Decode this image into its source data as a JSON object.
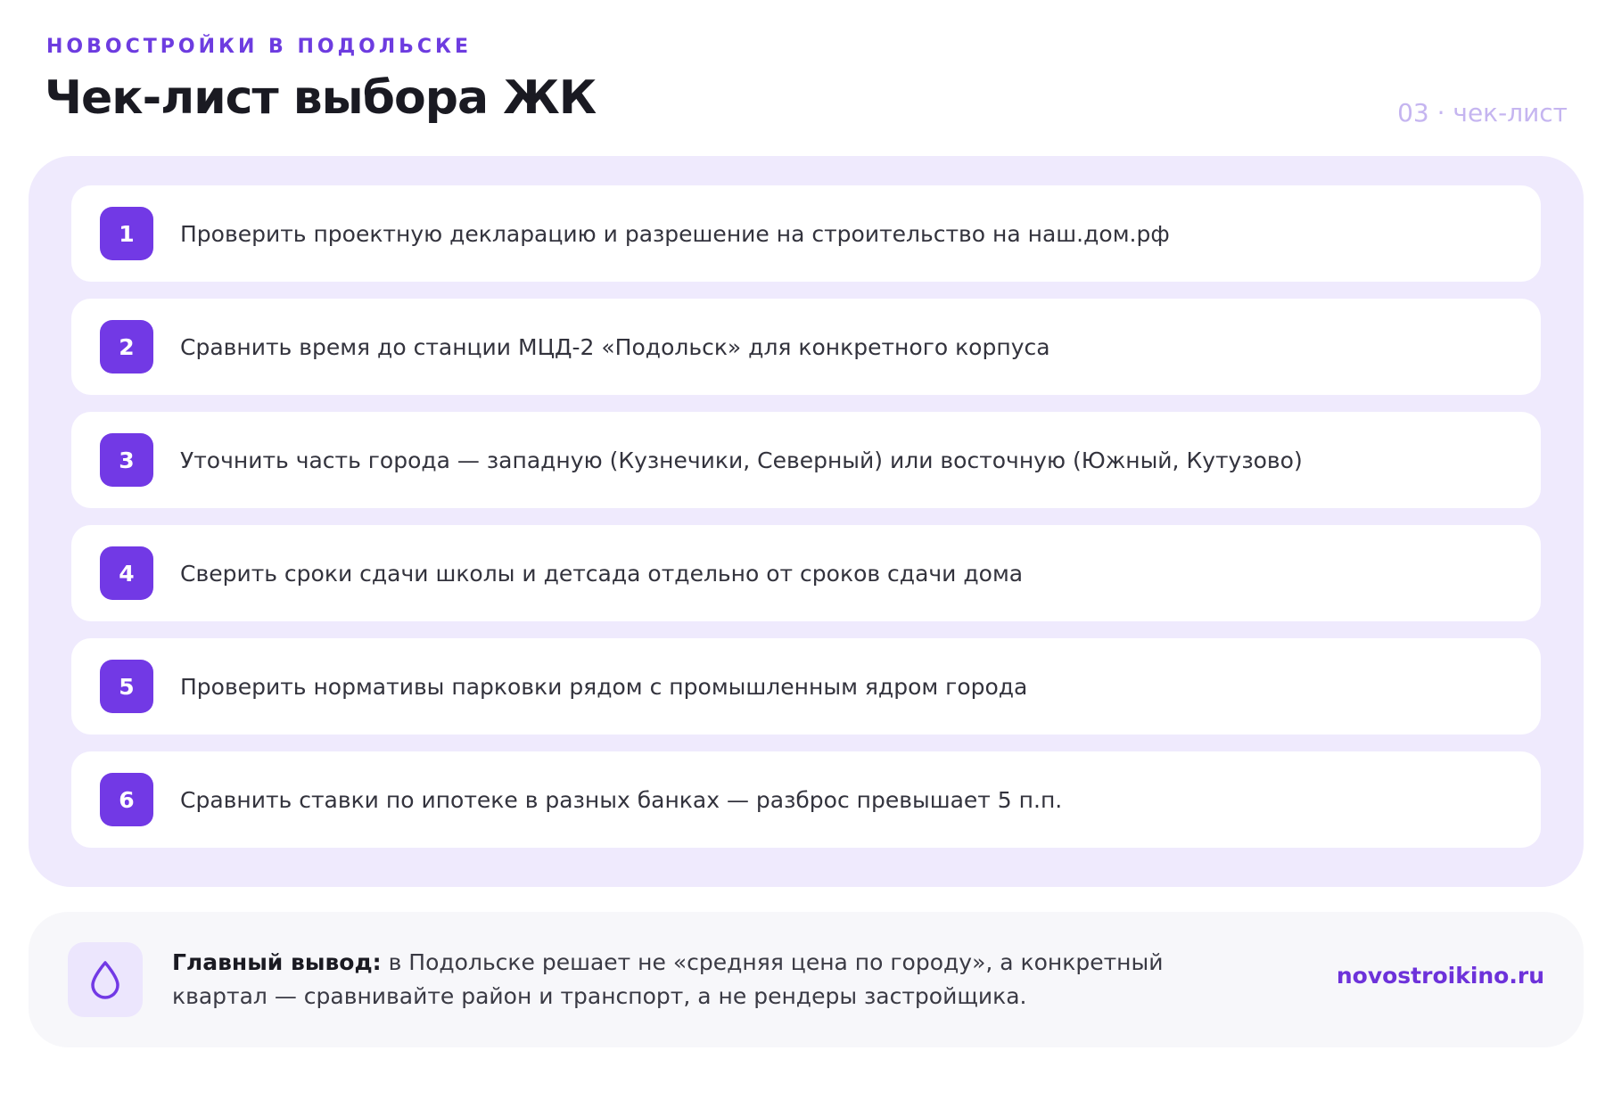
{
  "header": {
    "eyebrow": "НОВОСТРОЙКИ В ПОДОЛЬСКЕ",
    "title": "Чек-лист выбора ЖК",
    "meta": "03 · чек-лист"
  },
  "checklist": {
    "items": [
      {
        "number": "1",
        "text": "Проверить проектную декларацию и разрешение на строительство на наш.дом.рф"
      },
      {
        "number": "2",
        "text": "Сравнить время до станции МЦД-2 «Подольск» для конкретного корпуса"
      },
      {
        "number": "3",
        "text": "Уточнить часть города — западную (Кузнечики, Северный) или восточную (Южный, Кутузово)"
      },
      {
        "number": "4",
        "text": "Сверить сроки сдачи школы и детсада отдельно от сроков сдачи дома"
      },
      {
        "number": "5",
        "text": "Проверить нормативы парковки рядом с промышленным ядром города"
      },
      {
        "number": "6",
        "text": "Сравнить ставки по ипотеке в разных банках — разброс превышает 5 п.п."
      }
    ]
  },
  "conclusion": {
    "icon": "drop-icon",
    "label": "Главный вывод:",
    "text": " в Подольске решает не «средняя цена по городу», а конкретный квартал — сравнивайте район и транспорт, а не рендеры застройщика.",
    "link": "novostroikino.ru"
  },
  "colors": {
    "accent": "#7239e5",
    "panel": "#efeafd",
    "card": "#ffffff",
    "meta": "#c5b5f0"
  }
}
